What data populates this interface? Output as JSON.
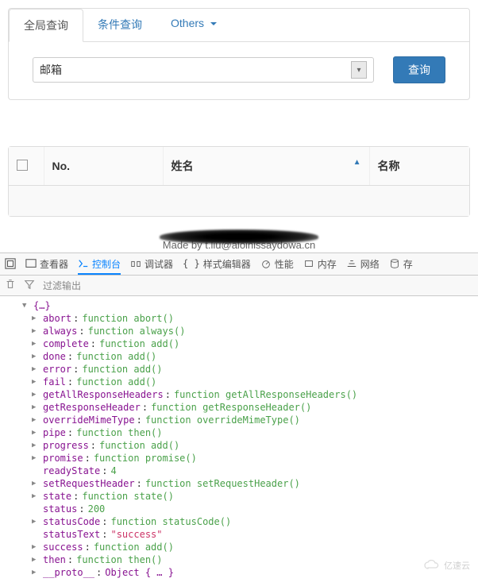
{
  "tabs": {
    "global": "全局查询",
    "cond": "条件查询",
    "others": "Others"
  },
  "search": {
    "selected": "邮箱",
    "button": "查询"
  },
  "table": {
    "no": "No.",
    "name": "姓名",
    "name2": "名称"
  },
  "footer": {
    "text": "Made by t.liu@aloinissaydowa.cn"
  },
  "dt": {
    "inspector": "查看器",
    "console": "控制台",
    "debugger": "调试器",
    "style": "样式编辑器",
    "perf": "性能",
    "memory": "内存",
    "network": "网络",
    "storage": "存",
    "filter": "过滤输出"
  },
  "obj": {
    "header": "{…}",
    "props": [
      {
        "k": "abort",
        "v": "function abort()",
        "t": "fn",
        "exp": true
      },
      {
        "k": "always",
        "v": "function always()",
        "t": "fn",
        "exp": true
      },
      {
        "k": "complete",
        "v": "function add()",
        "t": "fn",
        "exp": true
      },
      {
        "k": "done",
        "v": "function add()",
        "t": "fn",
        "exp": true
      },
      {
        "k": "error",
        "v": "function add()",
        "t": "fn",
        "exp": true
      },
      {
        "k": "fail",
        "v": "function add()",
        "t": "fn",
        "exp": true
      },
      {
        "k": "getAllResponseHeaders",
        "v": "function getAllResponseHeaders()",
        "t": "fn",
        "exp": true
      },
      {
        "k": "getResponseHeader",
        "v": "function getResponseHeader()",
        "t": "fn",
        "exp": true
      },
      {
        "k": "overrideMimeType",
        "v": "function overrideMimeType()",
        "t": "fn",
        "exp": true
      },
      {
        "k": "pipe",
        "v": "function then()",
        "t": "fn",
        "exp": true
      },
      {
        "k": "progress",
        "v": "function add()",
        "t": "fn",
        "exp": true
      },
      {
        "k": "promise",
        "v": "function promise()",
        "t": "fn",
        "exp": true
      },
      {
        "k": "readyState",
        "v": "4",
        "t": "num",
        "exp": false
      },
      {
        "k": "setRequestHeader",
        "v": "function setRequestHeader()",
        "t": "fn",
        "exp": true
      },
      {
        "k": "state",
        "v": "function state()",
        "t": "fn",
        "exp": true
      },
      {
        "k": "status",
        "v": "200",
        "t": "num",
        "exp": false
      },
      {
        "k": "statusCode",
        "v": "function statusCode()",
        "t": "fn",
        "exp": true
      },
      {
        "k": "statusText",
        "v": "\"success\"",
        "t": "str",
        "exp": false
      },
      {
        "k": "success",
        "v": "function add()",
        "t": "fn",
        "exp": true
      },
      {
        "k": "then",
        "v": "function then()",
        "t": "fn",
        "exp": true
      },
      {
        "k": "__proto__",
        "v": "Object { … }",
        "t": "key",
        "exp": true
      }
    ]
  },
  "watermark": "亿速云"
}
